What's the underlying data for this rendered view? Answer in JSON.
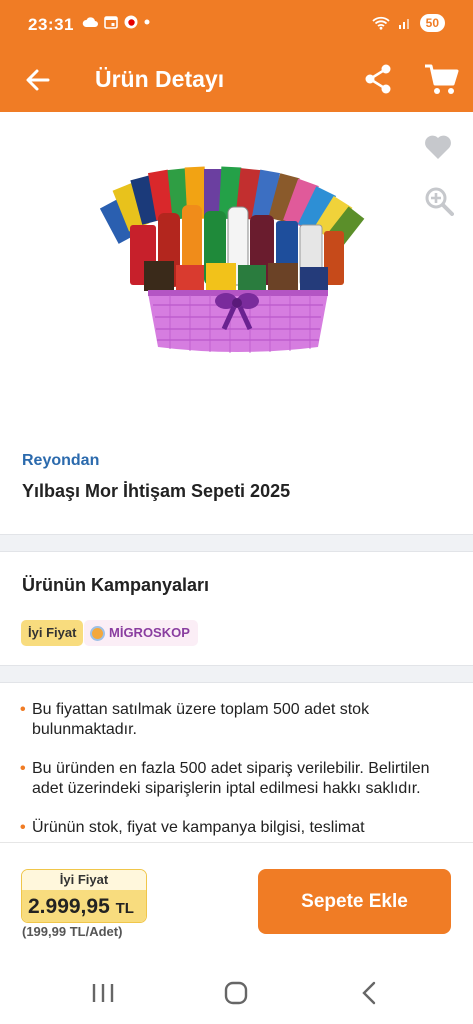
{
  "status_bar": {
    "time": "23:31",
    "battery": "50"
  },
  "header": {
    "title": "Ürün Detayı"
  },
  "product": {
    "brand": "Reyondan",
    "name": "Yılbaşı Mor İhtişam Sepeti 2025"
  },
  "campaigns": {
    "title": "Ürünün Kampanyaları",
    "badges": [
      "İyi Fiyat",
      "MİGROSKOP"
    ]
  },
  "info": {
    "items": [
      "Bu fiyattan satılmak üzere toplam 500 adet stok bulunmaktadır.",
      "Bu üründen en fazla 500 adet sipariş verilebilir. Belirtilen adet üzerindeki siparişlerin iptal edilmesi hakkı saklıdır.",
      "Ürünün stok, fiyat ve kampanya bilgisi, teslimat"
    ]
  },
  "price": {
    "label": "İyi Fiyat",
    "value": "2.999,95",
    "currency": "TL",
    "unit_price": "(199,99 TL/Adet)"
  },
  "add_to_cart_label": "Sepete Ekle",
  "colors": {
    "accent": "#f07c25",
    "brand_text": "#2b6aad",
    "price_badge": "#f8dc7e",
    "migroskop_text": "#8a3ea0"
  },
  "icons": [
    "back-arrow-icon",
    "share-icon",
    "cart-icon",
    "heart-icon",
    "zoom-in-icon",
    "cloud-icon",
    "calendar-icon",
    "vodafone-icon",
    "wifi-icon",
    "signal-icon"
  ]
}
